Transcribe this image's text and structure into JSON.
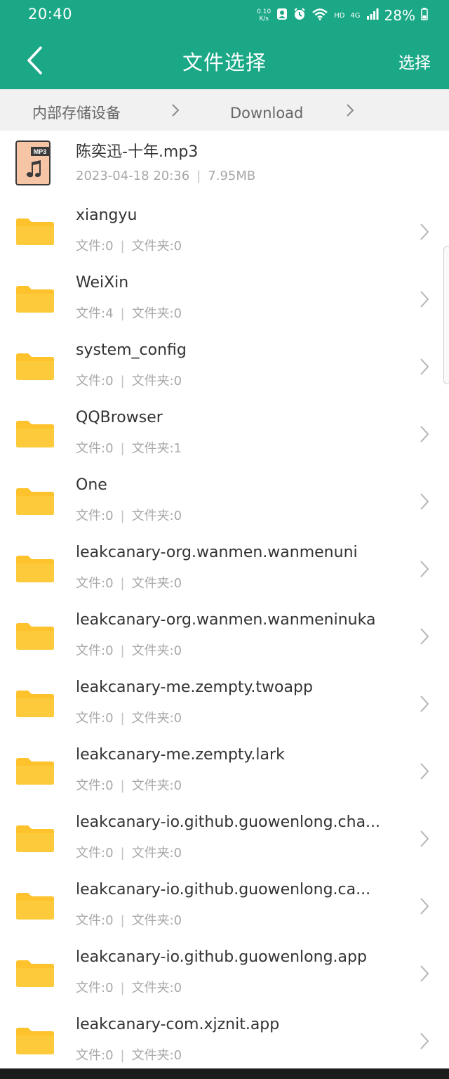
{
  "status_bar": {
    "time": "20:40",
    "net_speed_value": "0.10",
    "net_speed_unit": "K/s",
    "network_hd": "HD",
    "network_type": "4G",
    "battery": "28%",
    "icons": [
      "user-icon",
      "alarm-icon",
      "wifi-icon",
      "signal-icon",
      "battery-icon"
    ]
  },
  "header": {
    "title": "文件选择",
    "select_label": "选择",
    "back_icon": "chevron-left-icon"
  },
  "breadcrumb": {
    "items": [
      "内部存储设备",
      "Download"
    ]
  },
  "colors": {
    "header": "#1aa886",
    "breadcrumb_bg": "#f1f1f1",
    "folder": "#fdc22c",
    "mp3_icon": "#f6c5a5",
    "title_text": "#333333",
    "meta_text": "#a8a8a8"
  },
  "files": [
    {
      "type": "audio",
      "icon": "mp3-file-icon",
      "badge": "MP3",
      "name": "陈奕迅-十年.mp3",
      "meta_left": "2023-04-18 20:36",
      "meta_right": "7.95MB"
    },
    {
      "type": "folder",
      "icon": "folder-icon",
      "name": "xiangyu",
      "meta_left": "文件:0",
      "meta_right": "文件夹:0"
    },
    {
      "type": "folder",
      "icon": "folder-icon",
      "name": "WeiXin",
      "meta_left": "文件:4",
      "meta_right": "文件夹:0"
    },
    {
      "type": "folder",
      "icon": "folder-icon",
      "name": "system_config",
      "meta_left": "文件:0",
      "meta_right": "文件夹:0"
    },
    {
      "type": "folder",
      "icon": "folder-icon",
      "name": "QQBrowser",
      "meta_left": "文件:0",
      "meta_right": "文件夹:1"
    },
    {
      "type": "folder",
      "icon": "folder-icon",
      "name": "One",
      "meta_left": "文件:0",
      "meta_right": "文件夹:0"
    },
    {
      "type": "folder",
      "icon": "folder-icon",
      "name": "leakcanary-org.wanmen.wanmenuni",
      "meta_left": "文件:0",
      "meta_right": "文件夹:0"
    },
    {
      "type": "folder",
      "icon": "folder-icon",
      "name": "leakcanary-org.wanmen.wanmeninuka",
      "meta_left": "文件:0",
      "meta_right": "文件夹:0"
    },
    {
      "type": "folder",
      "icon": "folder-icon",
      "name": "leakcanary-me.zempty.twoapp",
      "meta_left": "文件:0",
      "meta_right": "文件夹:0"
    },
    {
      "type": "folder",
      "icon": "folder-icon",
      "name": "leakcanary-me.zempty.lark",
      "meta_left": "文件:0",
      "meta_right": "文件夹:0"
    },
    {
      "type": "folder",
      "icon": "folder-icon",
      "name": "leakcanary-io.github.guowenlong.cha...",
      "meta_left": "文件:0",
      "meta_right": "文件夹:0"
    },
    {
      "type": "folder",
      "icon": "folder-icon",
      "name": "leakcanary-io.github.guowenlong.ca...",
      "meta_left": "文件:0",
      "meta_right": "文件夹:0"
    },
    {
      "type": "folder",
      "icon": "folder-icon",
      "name": "leakcanary-io.github.guowenlong.app",
      "meta_left": "文件:0",
      "meta_right": "文件夹:0"
    },
    {
      "type": "folder",
      "icon": "folder-icon",
      "name": "leakcanary-com.xjznit.app",
      "meta_left": "文件:0",
      "meta_right": "文件夹:0"
    }
  ]
}
